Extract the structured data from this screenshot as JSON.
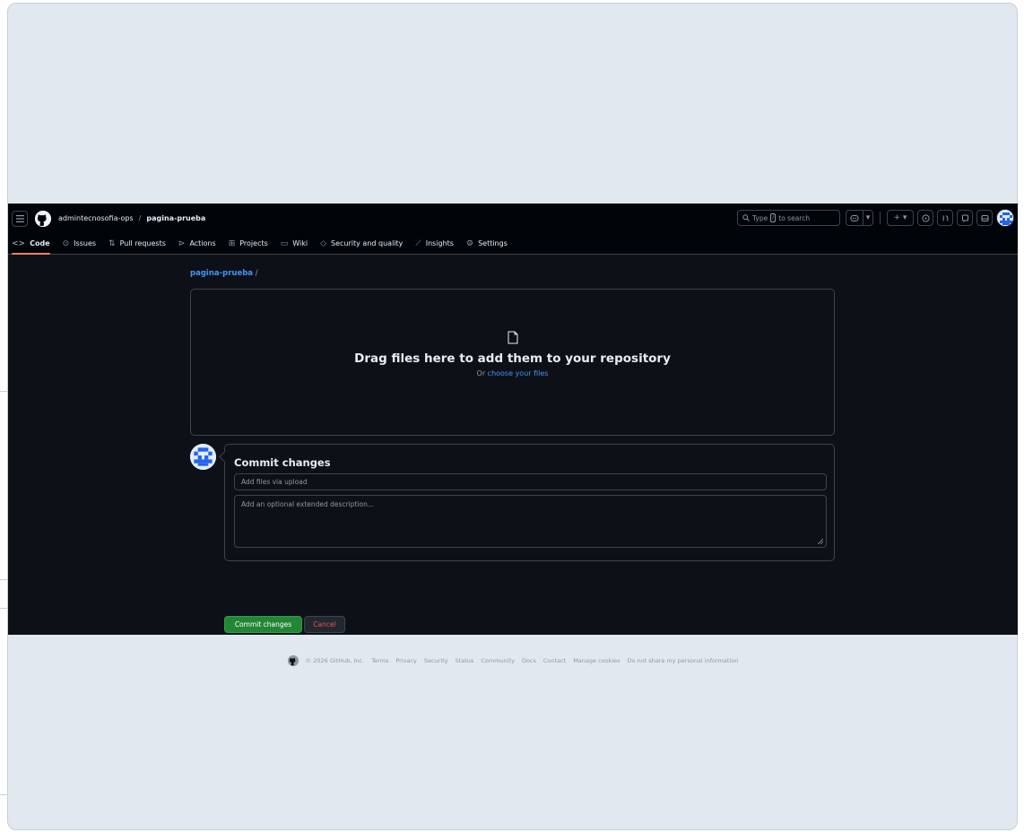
{
  "header": {
    "owner": "admintecnosofia-ops",
    "separator": "/",
    "repo": "pagina-prueba",
    "search_prefix": "Type",
    "search_key": "/",
    "search_suffix": "to search"
  },
  "tabs": [
    {
      "label": "Code",
      "icon": "code-icon",
      "active": true
    },
    {
      "label": "Issues",
      "icon": "issue-opened-icon"
    },
    {
      "label": "Pull requests",
      "icon": "git-pull-request-icon"
    },
    {
      "label": "Actions",
      "icon": "play-icon"
    },
    {
      "label": "Projects",
      "icon": "table-icon"
    },
    {
      "label": "Wiki",
      "icon": "book-icon"
    },
    {
      "label": "Security and quality",
      "icon": "shield-icon"
    },
    {
      "label": "Insights",
      "icon": "graph-icon"
    },
    {
      "label": "Settings",
      "icon": "gear-icon"
    }
  ],
  "main": {
    "path_repo": "pagina-prueba",
    "path_sep": "/",
    "drop_title": "Drag files here to add them to your repository",
    "drop_or": "Or",
    "drop_link": "choose your files"
  },
  "commit": {
    "title": "Commit changes",
    "summary_placeholder": "Add files via upload",
    "description_placeholder": "Add an optional extended description...",
    "commit_button": "Commit changes",
    "cancel_button": "Cancel"
  },
  "footer": {
    "copyright": "© 2026 GitHub, Inc.",
    "links": [
      "Terms",
      "Privacy",
      "Security",
      "Status",
      "Community",
      "Docs",
      "Contact",
      "Manage cookies",
      "Do not share my personal information"
    ]
  },
  "colors": {
    "accent_link": "#4493f8",
    "commit_green": "#238636",
    "cancel_red": "#f85149",
    "active_tab_underline": "#f78166",
    "background": "#0d1117"
  }
}
